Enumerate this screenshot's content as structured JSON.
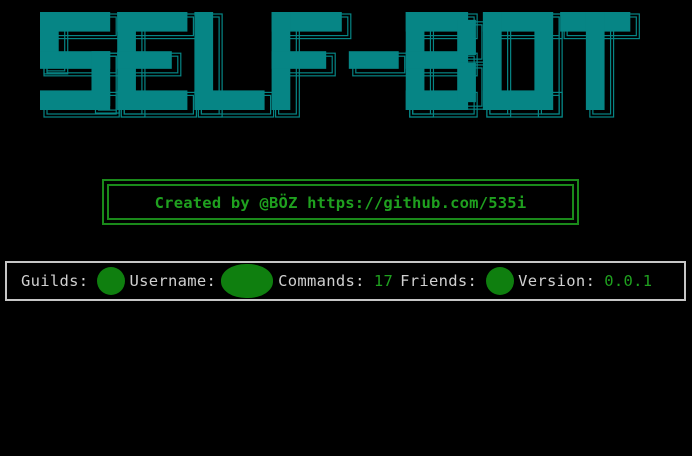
{
  "banner": {
    "text": "SELF-BOT",
    "fill_color": "#068585",
    "shadow_color": "#068585"
  },
  "credit": {
    "text": "Created by @BÖZ https://github.com/535i",
    "color": "#1fa01f"
  },
  "status": {
    "guilds_label": "Guilds:",
    "username_label": "Username:",
    "commands_label": "Commands:",
    "commands_value": "17",
    "friends_label": "Friends:",
    "version_label": "Version:",
    "version_value": "0.0.1",
    "redacted_color": "#0f7f0f"
  }
}
